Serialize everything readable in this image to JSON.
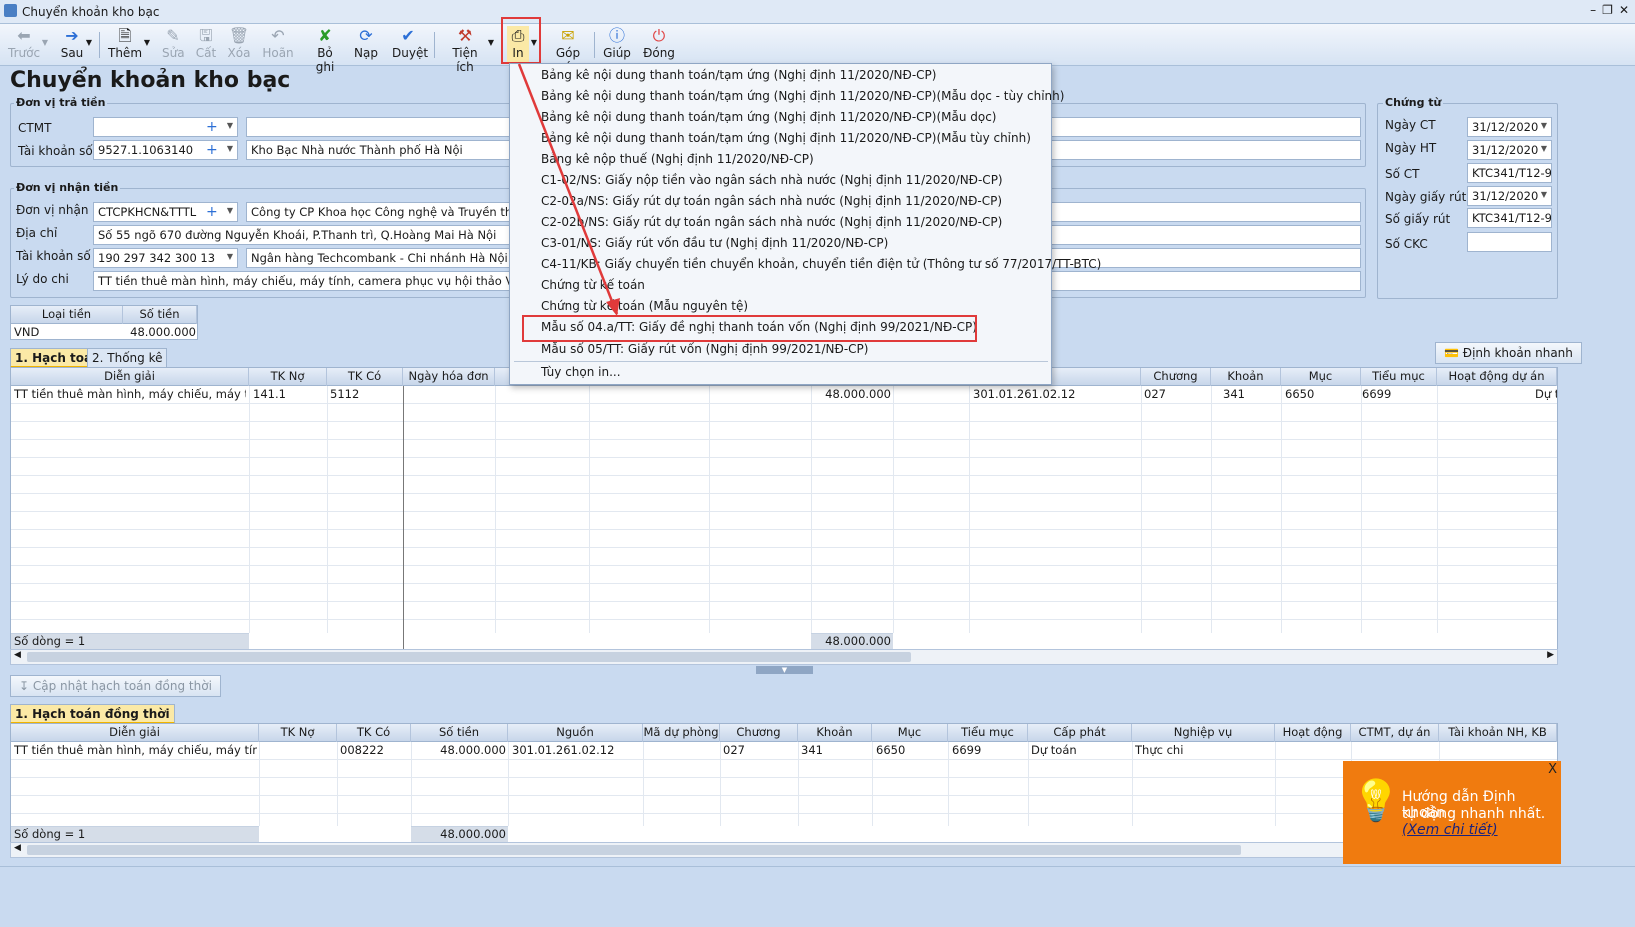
{
  "window": {
    "title": "Chuyển khoản kho bạc",
    "controls": [
      "–",
      "❐",
      "✕"
    ]
  },
  "toolbar": {
    "prev": "Trước",
    "next": "Sau",
    "add": "Thêm",
    "edit": "Sửa",
    "save": "Cất",
    "delete": "Xóa",
    "undo": "Hoãn",
    "unpost": "Bỏ ghi",
    "reload": "Nạp",
    "approve": "Duyệt",
    "utilities": "Tiện ích",
    "print": "In",
    "feedback": "Góp ý",
    "help": "Giúp",
    "close": "Đóng"
  },
  "page_title": "Chuyển khoản kho bạc",
  "payer": {
    "legend": "Đơn vị trả tiền",
    "ctmt_label": "CTMT",
    "ctmt_value": "",
    "ctmt_desc": "",
    "account_label": "Tài khoản số",
    "account_value": "9527.1.1063140",
    "account_name": "Kho Bạc Nhà nước Thành phố Hà Nội"
  },
  "payee": {
    "legend": "Đơn vị nhận tiền",
    "unit_label": "Đơn vị nhận",
    "unit_value": "CTCPKHCN&TTTL",
    "unit_name": "Công ty CP Khoa học Công nghệ và Truyền thông  Thă",
    "address_label": "Địa chỉ",
    "address_value": "Số 55 ngõ 670 đường Nguyễn Khoái, P.Thanh trì, Q.Hoàng Mai Hà Nội",
    "account_label": "Tài khoản số",
    "account_value": "190 297 342 300 13",
    "bank": "Ngân hàng Techcombank - Chi nhánh Hà Nội",
    "reason_label": "Lý do chi",
    "reason_value": "TT tiền thuê màn hình, máy chiếu, máy tính, camera phục vụ hội thảo Việt Nam-Hàn Q"
  },
  "voucher": {
    "legend": "Chứng từ",
    "date_ct_label": "Ngày CT",
    "date_ct": "31/12/2020",
    "date_ht_label": "Ngày HT",
    "date_ht": "31/12/2020",
    "so_ct_label": "Số CT",
    "so_ct": "KTC341/T12-9",
    "withdraw_date_label": "Ngày giấy rút",
    "withdraw_date": "31/12/2020",
    "withdraw_no_label": "Số giấy rút",
    "withdraw_no": "KTC341/T12-9",
    "ckc_label": "Số CKC",
    "ckc": ""
  },
  "currency": {
    "h1": "Loại tiền",
    "h2": "Số tiền",
    "type": "VND",
    "amount": "48.000.000"
  },
  "tabs": {
    "t1": "1. Hạch toán",
    "t2": "2. Thống kê",
    "t3": "1. Hạch toán đồng thời"
  },
  "quick_button": "Định khoản nhanh",
  "grid1": {
    "headers": [
      "Diễn giải",
      "TK Nợ",
      "TK Có",
      "Ngày hóa đơn",
      "n",
      "Chương",
      "Khoản",
      "Mục",
      "Tiểu mục",
      "Hoạt động dự án"
    ],
    "row": {
      "desc": "TT tiền thuê màn hình, máy chiếu, máy tính, ca...",
      "debit": "141.1",
      "credit": "5112",
      "amount": "48.000.000",
      "source": "301.01.261.02.12",
      "chapter": "027",
      "item": "341",
      "section": "6650",
      "subsection": "6699",
      "extra": "Dự to"
    },
    "footer_label": "Số dòng = 1",
    "footer_total": "48.000.000"
  },
  "update_button": "Cập nhật hạch toán đồng thời",
  "grid2": {
    "headers": [
      "Diễn giải",
      "TK Nợ",
      "TK Có",
      "Số tiền",
      "Nguồn",
      "Mã dự phòng",
      "Chương",
      "Khoản",
      "Mục",
      "Tiểu mục",
      "Cấp phát",
      "Nghiệp vụ",
      "Hoạt động",
      "CTMT, dự án",
      "Tài khoản NH, KB"
    ],
    "row": {
      "desc": "TT tiền thuê màn hình, máy chiếu, máy tính, cam...",
      "debit": "",
      "credit": "008222",
      "amount": "48.000.000",
      "source": "301.01.261.02.12",
      "reserve": "",
      "chapter": "027",
      "item": "341",
      "section": "6650",
      "subsection": "6699",
      "alloc": "Dự toán",
      "op": "Thực chi"
    },
    "footer_label": "Số dòng = 1",
    "footer_total": "48.000.000"
  },
  "print_menu": {
    "items": [
      "Bảng kê nội dung thanh toán/tạm ứng (Nghị định 11/2020/NĐ-CP)",
      "Bảng kê nội dung thanh toán/tạm ứng (Nghị định 11/2020/NĐ-CP)(Mẫu dọc - tùy chỉnh)",
      "Bảng kê nội dung thanh toán/tạm ứng (Nghị định 11/2020/NĐ-CP)(Mẫu dọc)",
      "Bảng kê nội dung thanh toán/tạm ứng (Nghị định 11/2020/NĐ-CP)(Mẫu tùy chỉnh)",
      "Bảng kê nộp thuế (Nghị định 11/2020/NĐ-CP)",
      "C1-02/NS: Giấy nộp tiền vào ngân sách nhà nước (Nghị định 11/2020/NĐ-CP)",
      "C2-02a/NS: Giấy rút dự toán ngân sách nhà nước (Nghị định 11/2020/NĐ-CP)",
      "C2-02b/NS: Giấy rút dự toán ngân sách nhà nước (Nghị định 11/2020/NĐ-CP)",
      "C3-01/NS: Giấy rút vốn đầu tư (Nghị định 11/2020/NĐ-CP)",
      "C4-11/KB: Giấy chuyển tiền chuyển khoản, chuyển tiền điện tử (Thông tư số 77/2017/TT-BTC)",
      "Chứng từ kế toán",
      "Chứng từ kế toán (Mẫu nguyên tệ)",
      "Mẫu số 04.a/TT: Giấy đề nghị thanh toán vốn (Nghị định 99/2021/NĐ-CP)",
      "Mẫu số 05/TT: Giấy rút vốn (Nghị định 99/2021/NĐ-CP)"
    ],
    "options": "Tùy chọn in..."
  },
  "tip": {
    "line1": "Hướng dẫn Định khoản",
    "line2": "tự động nhanh nhất.",
    "link": "(Xem chi tiết)",
    "close": "X"
  },
  "colors": {
    "highlight": "#e03a3a",
    "tip_bg": "#f07b0f"
  }
}
